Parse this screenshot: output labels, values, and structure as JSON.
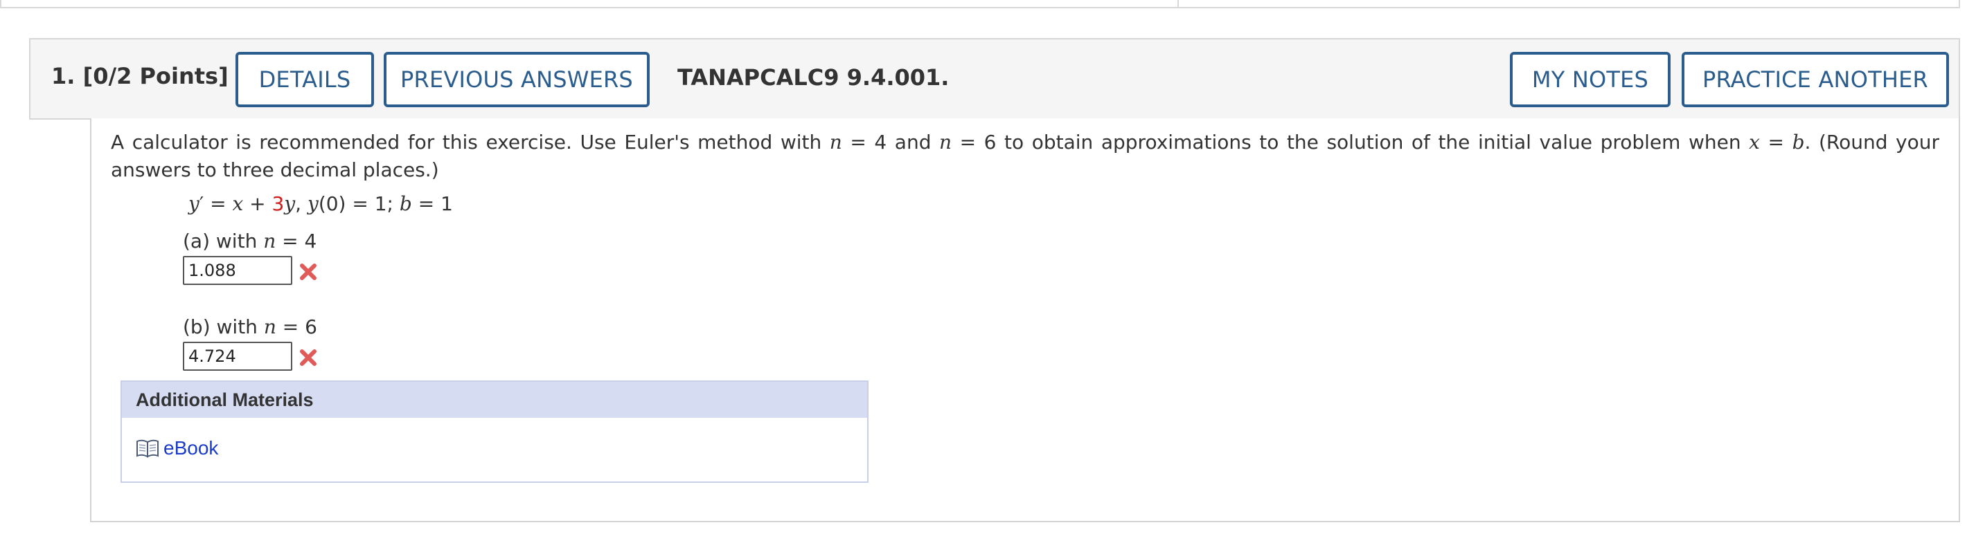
{
  "question": {
    "number_points": "1.  [0/2 Points]",
    "code": "TANAPCALC9 9.4.001.",
    "buttons": {
      "details": "DETAILS",
      "previous_answers": "PREVIOUS ANSWERS",
      "my_notes": "MY NOTES",
      "practice_another": "PRACTICE ANOTHER"
    }
  },
  "prompt": {
    "t1": "A calculator is recommended for this exercise. Use Euler's method with ",
    "n": "n",
    "t2": " = 4 and ",
    "t3": " = 6 to obtain approximations to the solution of the initial value problem when  ",
    "x": "x",
    "t4": " = ",
    "b": "b",
    "t5": ".  (Round your answers to three decimal places.)"
  },
  "equation": {
    "y": "y",
    "prime": "′ = ",
    "x": "x",
    "plus": " + ",
    "coef": "3",
    "y2": "y",
    "mid": ",  ",
    "y3": "y",
    "init": "(0) = 1;  ",
    "b": "b",
    "end": " = 1"
  },
  "parts": [
    {
      "label": "(a) with ",
      "var": "n",
      "eq": " = 4",
      "answer": "1.088",
      "status": "incorrect"
    },
    {
      "label": "(b) with ",
      "var": "n",
      "eq": " = 6",
      "answer": "4.724",
      "status": "incorrect"
    }
  ],
  "colors": {
    "button_border": "#2a5c8e",
    "incorrect_mark": "#e05a5a",
    "coef_red": "#d41c1c",
    "link": "#1a3cc8",
    "materials_header_bg": "#d6dcf1"
  },
  "additional_materials": {
    "title": "Additional Materials",
    "ebook_icon": "open-book-icon",
    "ebook_label": "eBook"
  }
}
